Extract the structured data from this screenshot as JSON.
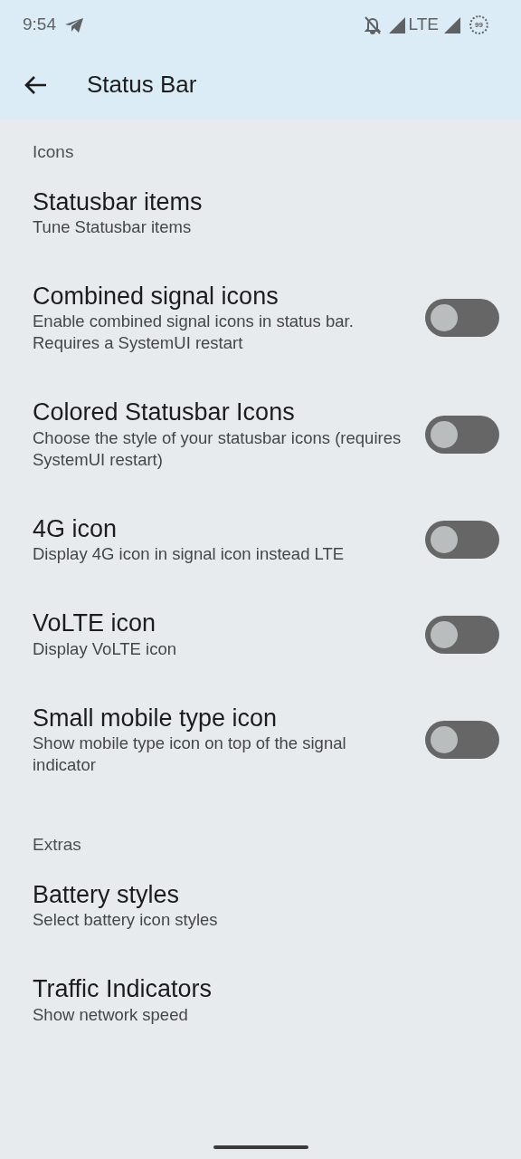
{
  "status_bar": {
    "time": "9:54",
    "network": "LTE",
    "battery": "99"
  },
  "app_bar": {
    "title": "Status Bar"
  },
  "sections": [
    {
      "title": "Icons",
      "items": [
        {
          "kind": "link",
          "title": "Statusbar items",
          "summary": "Tune Statusbar items"
        },
        {
          "kind": "switch",
          "title": "Combined signal icons",
          "summary": "Enable combined signal icons in status bar. Requires a SystemUI restart",
          "on": false
        },
        {
          "kind": "switch",
          "title": "Colored Statusbar Icons",
          "summary": "Choose the style of your statusbar icons (requires SystemUI restart)",
          "on": false
        },
        {
          "kind": "switch",
          "title": "4G icon",
          "summary": "Display 4G icon in signal icon instead LTE",
          "on": false
        },
        {
          "kind": "switch",
          "title": "VoLTE icon",
          "summary": "Display VoLTE icon",
          "on": false
        },
        {
          "kind": "switch",
          "title": "Small mobile type icon",
          "summary": "Show mobile type icon on top of the signal indicator",
          "on": false
        }
      ]
    },
    {
      "title": "Extras",
      "items": [
        {
          "kind": "link",
          "title": "Battery styles",
          "summary": "Select battery icon styles"
        },
        {
          "kind": "link",
          "title": "Traffic Indicators",
          "summary": "Show network speed"
        }
      ]
    }
  ]
}
